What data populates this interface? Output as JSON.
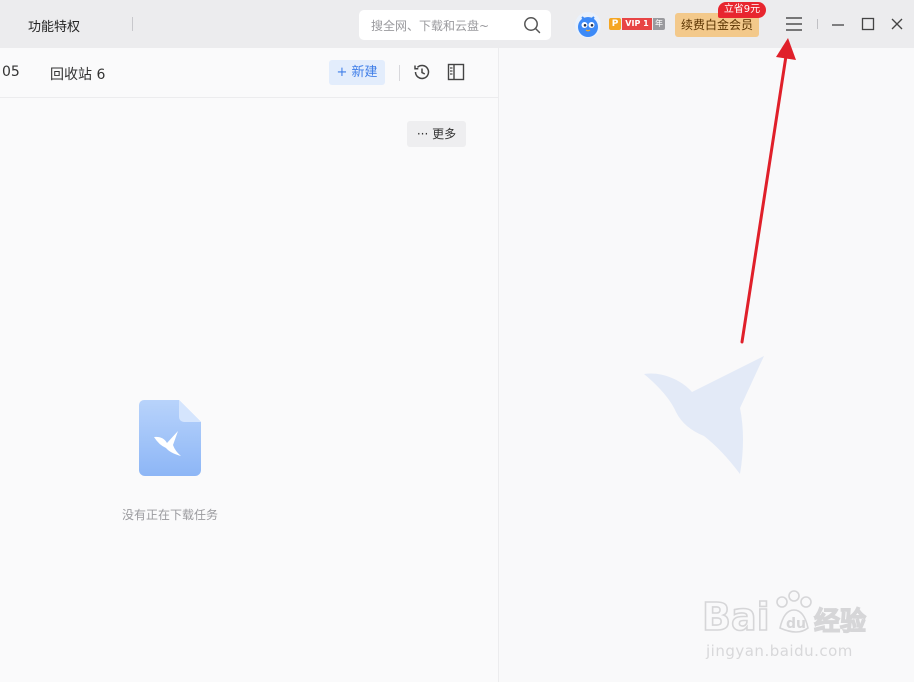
{
  "topbar": {
    "title": "功能特权",
    "search_placeholder": "搜全网、下载和云盘~",
    "vip": {
      "p": "P",
      "label": "VIP 1",
      "year": "年"
    },
    "renew_label": "续费白金会员",
    "promo_label": "立省9元"
  },
  "toolbar": {
    "tab_count_fragment": "05",
    "recycle_label": "回收站 6",
    "new_label": "+ 新建"
  },
  "content": {
    "more_label": "··· 更多",
    "empty_message": "没有正在下载任务"
  },
  "watermark": {
    "brand": "Bai 经验",
    "url": "jingyan.baidu.com"
  },
  "colors": {
    "accent_blue": "#3f7ee8",
    "renew_gold": "#f3c98b",
    "promo_red": "#e8262f",
    "arrow_red": "#e0202a"
  }
}
